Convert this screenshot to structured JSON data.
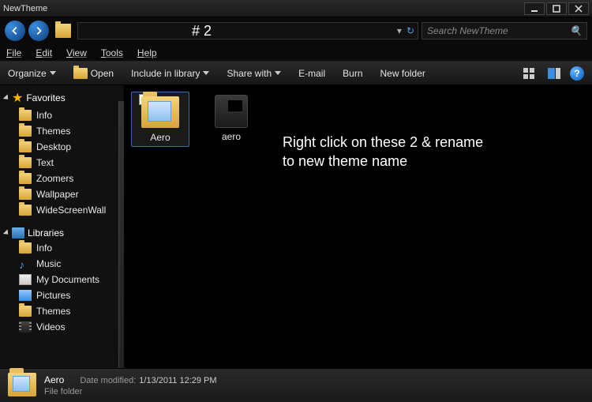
{
  "window": {
    "title": "NewTheme"
  },
  "annotation_number": "# 2",
  "search": {
    "placeholder": "Search NewTheme"
  },
  "menu": {
    "file": "File",
    "edit": "Edit",
    "view": "View",
    "tools": "Tools",
    "help": "Help"
  },
  "toolbar": {
    "organize": "Organize",
    "open": "Open",
    "include": "Include in library",
    "share": "Share with",
    "email": "E-mail",
    "burn": "Burn",
    "newfolder": "New folder"
  },
  "sidebar": {
    "favorites": {
      "header": "Favorites",
      "items": [
        "Info",
        "Themes",
        "Desktop",
        "Text",
        "Zoomers",
        "Wallpaper",
        "WideScreenWall"
      ]
    },
    "libraries": {
      "header": "Libraries",
      "items": [
        "Info",
        "Music",
        "My Documents",
        "Pictures",
        "Themes",
        "Videos"
      ]
    }
  },
  "content": {
    "items": [
      {
        "name": "Aero",
        "kind": "folder",
        "selected": true
      },
      {
        "name": "aero",
        "kind": "file",
        "selected": false
      }
    ]
  },
  "annotation_text": {
    "l1": "Right click on these 2 & rename",
    "l2": "to new theme name"
  },
  "details": {
    "name": "Aero",
    "type": "File folder",
    "modified_label": "Date modified:",
    "modified_value": "1/13/2011 12:29 PM"
  }
}
